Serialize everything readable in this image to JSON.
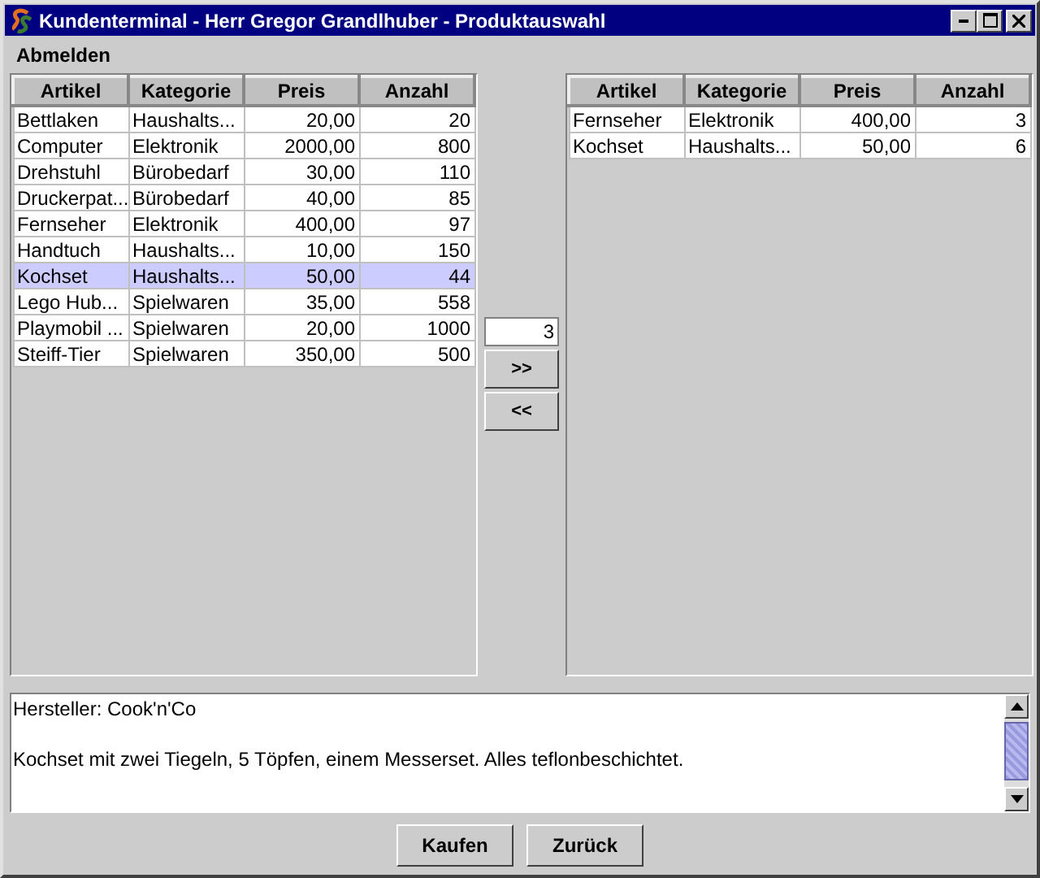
{
  "window": {
    "title": "Kundenterminal - Herr Gregor Grandlhuber - Produktauswahl"
  },
  "menu": [
    "Abmelden"
  ],
  "left_table": {
    "columns": [
      "Artikel",
      "Kategorie",
      "Preis",
      "Anzahl"
    ],
    "rows": [
      {
        "cells": [
          "Bettlaken",
          "Haushalts...",
          "20,00",
          "20"
        ],
        "selected": false
      },
      {
        "cells": [
          "Computer",
          "Elektronik",
          "2000,00",
          "800"
        ],
        "selected": false
      },
      {
        "cells": [
          "Drehstuhl",
          "Bürobedarf",
          "30,00",
          "110"
        ],
        "selected": false
      },
      {
        "cells": [
          "Druckerpat...",
          "Bürobedarf",
          "40,00",
          "85"
        ],
        "selected": false
      },
      {
        "cells": [
          "Fernseher",
          "Elektronik",
          "400,00",
          "97"
        ],
        "selected": false
      },
      {
        "cells": [
          "Handtuch",
          "Haushalts...",
          "10,00",
          "150"
        ],
        "selected": false
      },
      {
        "cells": [
          "Kochset",
          "Haushalts...",
          "50,00",
          "44"
        ],
        "selected": true
      },
      {
        "cells": [
          "Lego Hub...",
          "Spielwaren",
          "35,00",
          "558"
        ],
        "selected": false
      },
      {
        "cells": [
          "Playmobil ...",
          "Spielwaren",
          "20,00",
          "1000"
        ],
        "selected": false
      },
      {
        "cells": [
          "Steiff-Tier",
          "Spielwaren",
          "350,00",
          "500"
        ],
        "selected": false
      }
    ]
  },
  "quantity": {
    "value": "3"
  },
  "move_buttons": [
    ">>",
    "<<"
  ],
  "right_table": {
    "columns": [
      "Artikel",
      "Kategorie",
      "Preis",
      "Anzahl"
    ],
    "rows": [
      {
        "cells": [
          "Fernseher",
          "Elektronik",
          "400,00",
          "3"
        ],
        "selected": false
      },
      {
        "cells": [
          "Kochset",
          "Haushalts...",
          "50,00",
          "6"
        ],
        "selected": false
      }
    ]
  },
  "description": [
    "Hersteller: Cook'n'Co",
    "Kochset mit zwei Tiegeln, 5 Töpfen, einem Messerset. Alles teflonbeschichtet."
  ],
  "buttons": [
    "Kaufen",
    "Zurück"
  ]
}
